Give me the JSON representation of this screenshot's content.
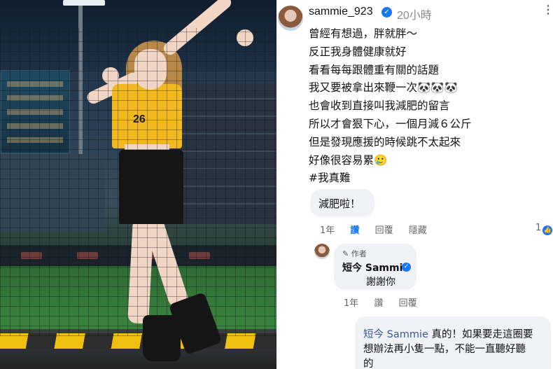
{
  "post": {
    "username": "sammie_923",
    "verified_icon": "verified-badge-icon",
    "timestamp": "20小時",
    "more_icon": "more-options-icon",
    "caption_lines": [
      "曾經有想過，胖就胖～",
      "反正我身體健康就好",
      "看看每每跟體重有關的話題",
      "我又要被拿出來鞭一次🐼🐼🐼",
      "也會收到直接叫我減肥的留言",
      "所以才會狠下心，一個月減６公斤",
      "但是發現應援的時候跳不太起來",
      "好像很容易累🥲",
      "#我真難"
    ]
  },
  "comments": [
    {
      "text": "減肥啦！",
      "time": "1年",
      "like_label": "讚",
      "reply_label": "回覆",
      "hide_label": "隱藏",
      "likes": "1",
      "like_icon": "thumbs-up-icon"
    },
    {
      "author_tag": "✎ 作者",
      "name": "短今 Sammie",
      "text": "謝謝你",
      "time": "1年",
      "like_label": "讚",
      "reply_label": "回覆"
    },
    {
      "mention": "短今 Sammie",
      "text_1": " 真的！如果要走這圈要",
      "text_2": "想辦法再小隻一點，不能一直聽好聽",
      "text_3": "的"
    }
  ],
  "photo": {
    "jersey_number": "26"
  },
  "colors": {
    "accent": "#1877f2",
    "comment_bg": "#f0f2f5",
    "jersey": "#f2b91e"
  }
}
